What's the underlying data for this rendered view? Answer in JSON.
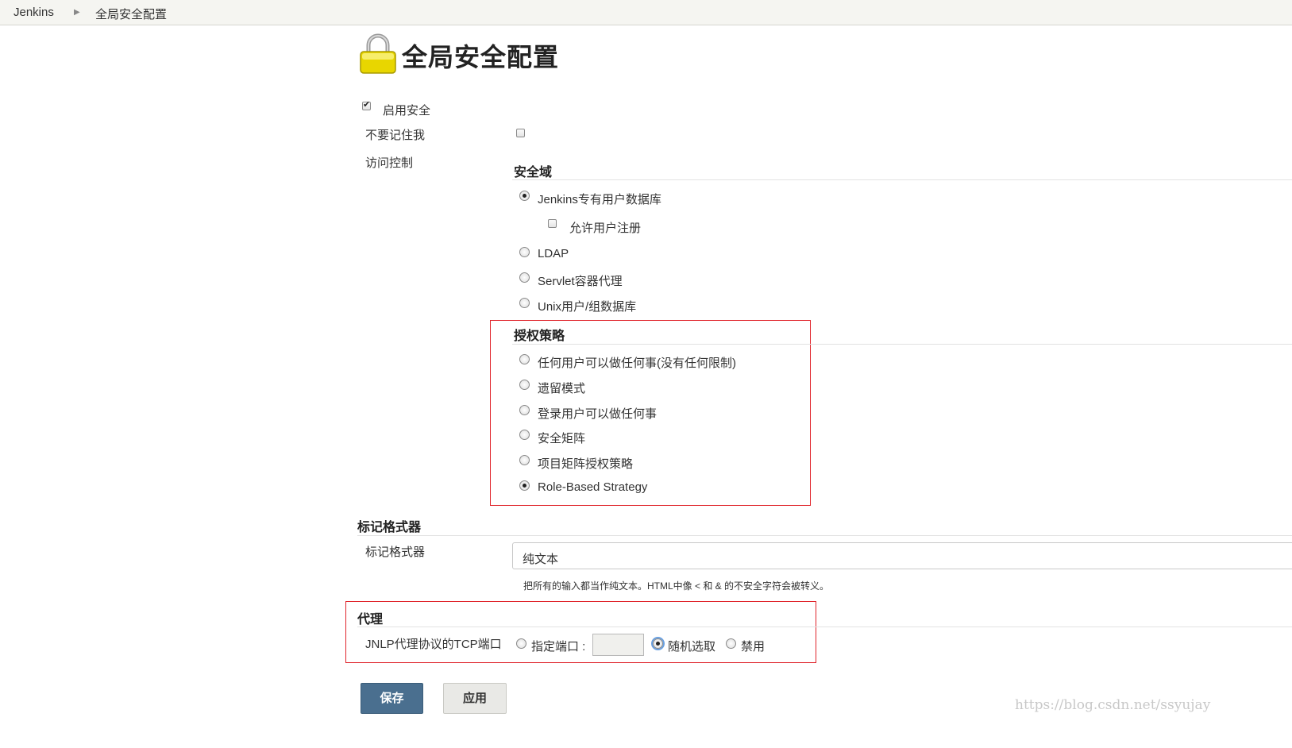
{
  "breadcrumb": {
    "items": [
      "Jenkins",
      "全局安全配置"
    ],
    "separator_icon": "chevron-right-icon"
  },
  "page": {
    "title": "全局安全配置",
    "icon": "lock-icon"
  },
  "security": {
    "enable_label": "启用安全",
    "enable_checked": true,
    "remember_me_label": "不要记住我",
    "remember_me_checked": false,
    "access_control_label": "访问控制"
  },
  "realm": {
    "heading": "安全域",
    "options": [
      {
        "label": "Jenkins专有用户数据库",
        "selected": true
      },
      {
        "label": "LDAP",
        "selected": false
      },
      {
        "label": "Servlet容器代理",
        "selected": false
      },
      {
        "label": "Unix用户/组数据库",
        "selected": false
      }
    ],
    "allow_signup_label": "允许用户注册",
    "allow_signup_checked": false
  },
  "authorization": {
    "heading": "授权策略",
    "options": [
      {
        "label": "任何用户可以做任何事(没有任何限制)",
        "selected": false
      },
      {
        "label": "遗留模式",
        "selected": false
      },
      {
        "label": "登录用户可以做任何事",
        "selected": false
      },
      {
        "label": "安全矩阵",
        "selected": false
      },
      {
        "label": "项目矩阵授权策略",
        "selected": false
      },
      {
        "label": "Role-Based Strategy",
        "selected": true
      }
    ]
  },
  "markup": {
    "heading": "标记格式器",
    "field_label": "标记格式器",
    "selected_value": "纯文本",
    "help_text": "把所有的输入都当作纯文本。HTML中像 < 和 & 的不安全字符会被转义。"
  },
  "proxy": {
    "heading": "代理",
    "jnlp_label": "JNLP代理协议的TCP端口",
    "fixed_label": "指定端口 :",
    "fixed_selected": false,
    "port_value": "",
    "random_label": "随机选取",
    "random_selected": true,
    "disable_label": "禁用",
    "disable_selected": false
  },
  "buttons": {
    "save_label": "保存",
    "apply_label": "应用"
  },
  "watermark": "https://blog.csdn.net/ssyujay",
  "colors": {
    "highlight_box": "#e0242b",
    "save_button": "#4a6f8f",
    "breadcrumb_bg": "#f5f5f1"
  }
}
